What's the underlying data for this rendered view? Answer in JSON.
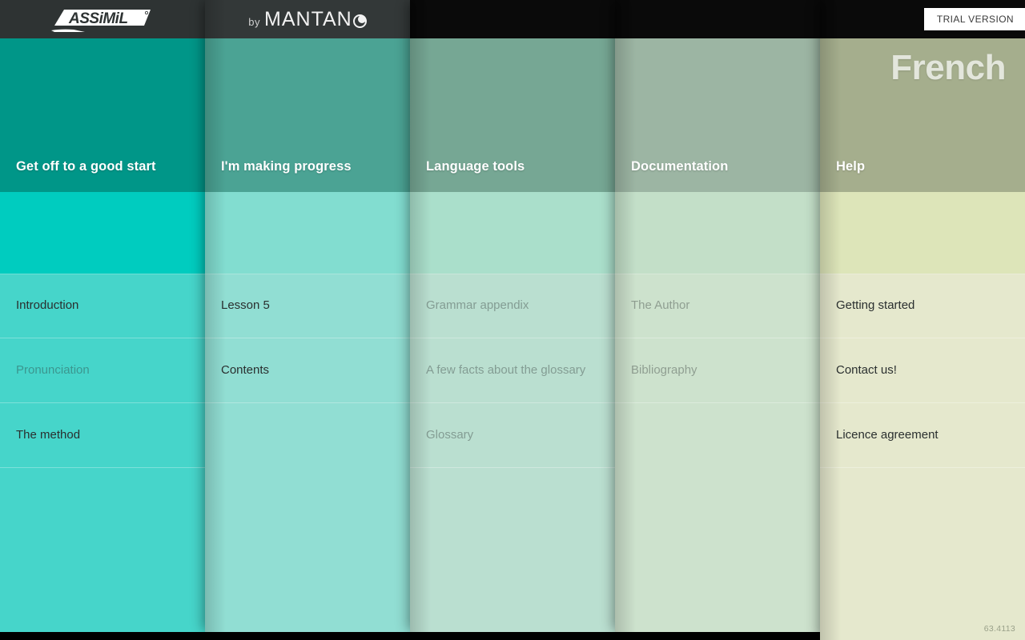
{
  "brand": {
    "assimil": "ASSIMIL",
    "by": "by",
    "mantano": "MANTAN",
    "mantano_full": "by MANTANO"
  },
  "trial": {
    "label": "TRIAL VERSION"
  },
  "language": {
    "title": "French"
  },
  "version": {
    "label": "63.4113"
  },
  "colors": {
    "col1_header": "#009688",
    "col1_band": "#00ccbf",
    "col1_body": "#46d5ca",
    "col2_header": "#4ba394",
    "col2_band": "#82ddd0",
    "col2_body": "#91ded3",
    "col3_header": "#76a794",
    "col3_band": "#aadfcb",
    "col3_body": "#badfd0",
    "col4_header": "#9cb5a3",
    "col4_band": "#c3dfc8",
    "col4_body": "#cde2cd",
    "col5_header": "#a5ae8d",
    "col5_band": "#dde5b9",
    "col5_body": "#e5e8cd",
    "banner": "#2e3333",
    "trial_bg": "#ffffff",
    "title_text": "#e3e6dc"
  },
  "columns": [
    {
      "title": "Get off to a good start",
      "items": [
        {
          "label": "Introduction",
          "dim": false
        },
        {
          "label": "Pronunciation",
          "dim": true
        },
        {
          "label": "The method",
          "dim": false
        }
      ]
    },
    {
      "title": "I'm making progress",
      "items": [
        {
          "label": "Lesson 5",
          "dim": false
        },
        {
          "label": "Contents",
          "dim": false
        }
      ]
    },
    {
      "title": "Language tools",
      "items": [
        {
          "label": "Grammar appendix",
          "dim": true
        },
        {
          "label": "A few facts about the glossary",
          "dim": true
        },
        {
          "label": "Glossary",
          "dim": true
        }
      ]
    },
    {
      "title": "Documentation",
      "items": [
        {
          "label": "The Author",
          "dim": true
        },
        {
          "label": "Bibliography",
          "dim": true
        }
      ]
    },
    {
      "title": "Help",
      "items": [
        {
          "label": "Getting started",
          "dim": false
        },
        {
          "label": "Contact us!",
          "dim": false
        },
        {
          "label": "Licence agreement",
          "dim": false
        }
      ]
    }
  ]
}
